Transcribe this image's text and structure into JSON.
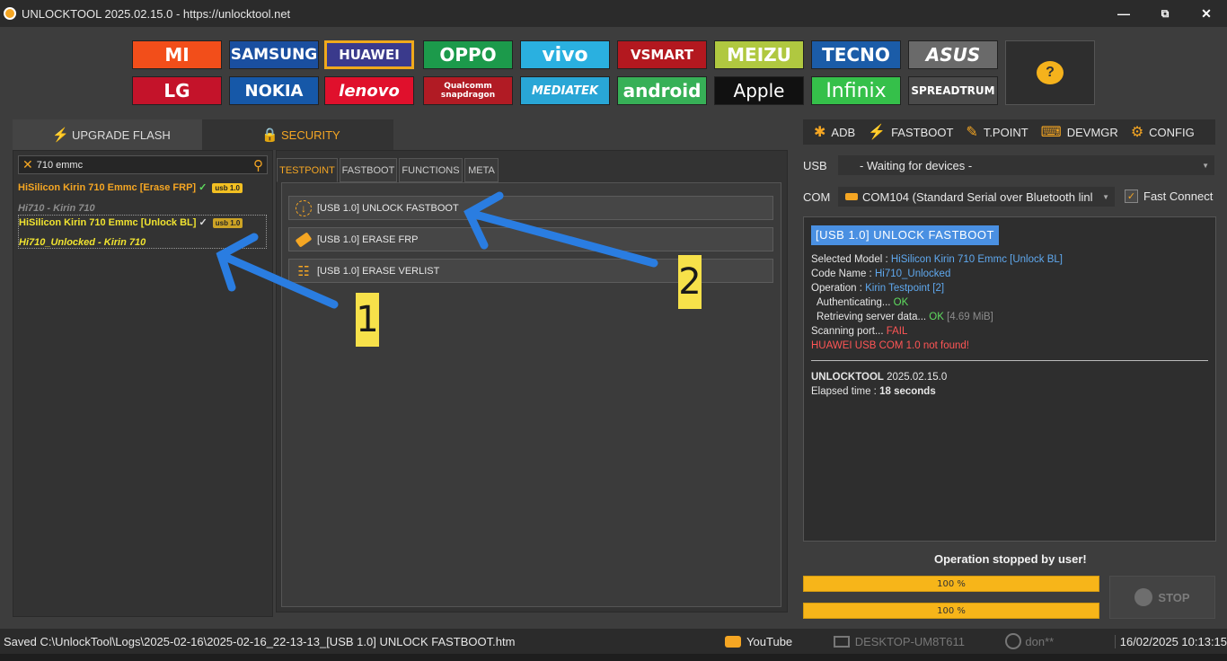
{
  "window": {
    "title": "UNLOCKTOOL 2025.02.15.0 - https://unlocktool.net",
    "minimize": "—",
    "maximize": "⧉",
    "close": "✕"
  },
  "brands_row1": [
    "MI",
    "SAMSUNG",
    "HUAWEI",
    "OPPO",
    "vivo",
    "VSMART",
    "MEIZU",
    "TECNO",
    "ASUS"
  ],
  "brands_row2": [
    "LG",
    "NOKIA",
    "lenovo",
    "Qualcomm snapdragon",
    "MEDIATEK",
    "android",
    "Apple",
    "Infinix",
    "SPREADTRUM"
  ],
  "brand_colors_row1": [
    "#f24e1a",
    "#1a4fa0",
    "#3a3a8c",
    "#1c9a4b",
    "#2ab0e0",
    "#b3181f",
    "#b0c840",
    "#1b5ca8",
    "#6a6a6a"
  ],
  "brand_colors_row2": [
    "#c4132a",
    "#1658a8",
    "#e0102c",
    "#b11b24",
    "#29a6d6",
    "#37b057",
    "#111111",
    "#35c04a",
    "#4a4a4a"
  ],
  "help": {
    "label": "?"
  },
  "main_tabs": [
    {
      "label": "UPGRADE FLASH"
    },
    {
      "label": "SECURITY"
    }
  ],
  "search": {
    "value": "710 emmc"
  },
  "model_list": [
    {
      "name": "HiSilicon Kirin 710 Emmc [Erase FRP]",
      "check": "✓",
      "badge": "usb 1.0",
      "sub": "Hi710 - Kirin 710"
    },
    {
      "name": "HiSilicon Kirin 710 Emmc [Unlock BL]",
      "check": "✓",
      "badge": "usb 1.0",
      "sub": "Hi710_Unlocked - Kirin 710"
    }
  ],
  "sub_tabs": [
    "TESTPOINT",
    "FASTBOOT",
    "FUNCTIONS",
    "META"
  ],
  "functions": [
    "[USB 1.0] UNLOCK FASTBOOT",
    "[USB 1.0] ERASE FRP",
    "[USB 1.0] ERASE VERLIST"
  ],
  "right_toolbar": [
    "ADB",
    "FASTBOOT",
    "T.POINT",
    "DEVMGR",
    "CONFIG"
  ],
  "usb": {
    "label": "USB",
    "value": "- Waiting for devices -"
  },
  "com": {
    "label": "COM",
    "value": "COM104 (Standard Serial over Bluetooth linl",
    "fast_connect": "Fast Connect",
    "fast_checked": "✓"
  },
  "log": {
    "header": "[USB 1.0]  UNLOCK FASTBOOT",
    "selected_model_k": "Selected Model : ",
    "selected_model_v": "HiSilicon Kirin 710 Emmc [Unlock BL]",
    "code_name_k": "Code Name : ",
    "code_name_v": "Hi710_Unlocked",
    "operation_k": "Operation : ",
    "operation_v": "Kirin Testpoint [2]",
    "auth_k": "Authenticating... ",
    "auth_v": "OK",
    "retr_k": "Retrieving server data... ",
    "retr_v": "OK",
    "retr_size": "[4.69 MiB]",
    "scan_k": "Scanning port... ",
    "scan_v": "FAIL",
    "error": "HUAWEI USB COM 1.0 not found!",
    "ver_k": "UNLOCKTOOL",
    "ver_v": " 2025.02.15.0",
    "elapsed_k": "Elapsed time : ",
    "elapsed_v": "18 seconds"
  },
  "status_message": "Operation stopped by user!",
  "progress": [
    {
      "label": "100 %",
      "value": 1.0
    },
    {
      "label": "100 %",
      "value": 1.0
    }
  ],
  "stop": {
    "label": "STOP"
  },
  "statusbar": {
    "saved": "Saved C:\\UnlockTool\\Logs\\2025-02-16\\2025-02-16_22-13-13_[USB 1.0] UNLOCK FASTBOOT.htm",
    "youtube": "YouTube",
    "computer": "DESKTOP-UM8T611",
    "user": "don**",
    "datetime": "16/02/2025 10:13:15"
  },
  "annotations": {
    "tag1": "1",
    "tag2": "2"
  }
}
